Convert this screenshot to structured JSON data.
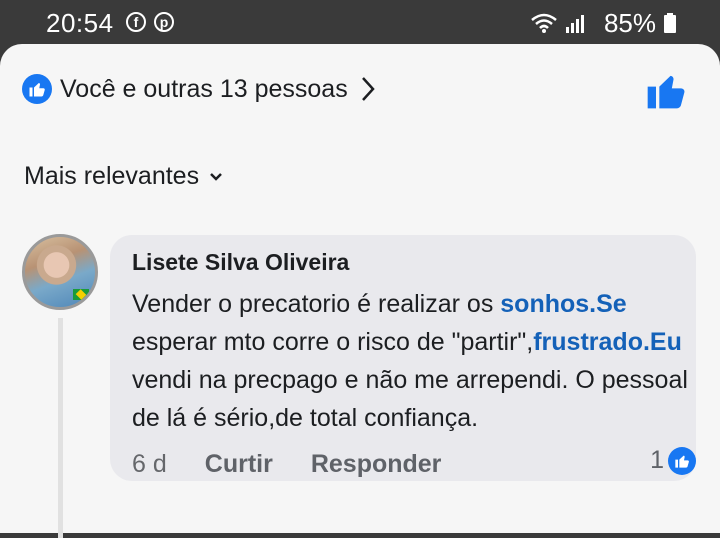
{
  "status_bar": {
    "time": "20:54",
    "battery": "85%"
  },
  "post": {
    "reactions_text": "Você e outras 13 pessoas",
    "filter_label": "Mais relevantes"
  },
  "comment": {
    "author": "Lisete Silva Oliveira",
    "segments": [
      {
        "text": "Vender o precatorio é realizar os ",
        "link": false
      },
      {
        "text": "sonhos.Se",
        "link": true
      },
      {
        "text": " esperar mto corre o risco de \"partir\",",
        "link": false
      },
      {
        "text": "frustrado.Eu",
        "link": true
      },
      {
        "text": " vendi na precpago e não me arrependi. O pessoal de lá é sério,de total confiança.",
        "link": false
      }
    ],
    "time": "6 d",
    "like_label": "Curtir",
    "reply_label": "Responder",
    "reaction_count": "1"
  },
  "colors": {
    "accent": "#1877f2",
    "link": "#1461b8",
    "bubble": "#e9e9ed",
    "sheet": "#f6f6f6"
  }
}
